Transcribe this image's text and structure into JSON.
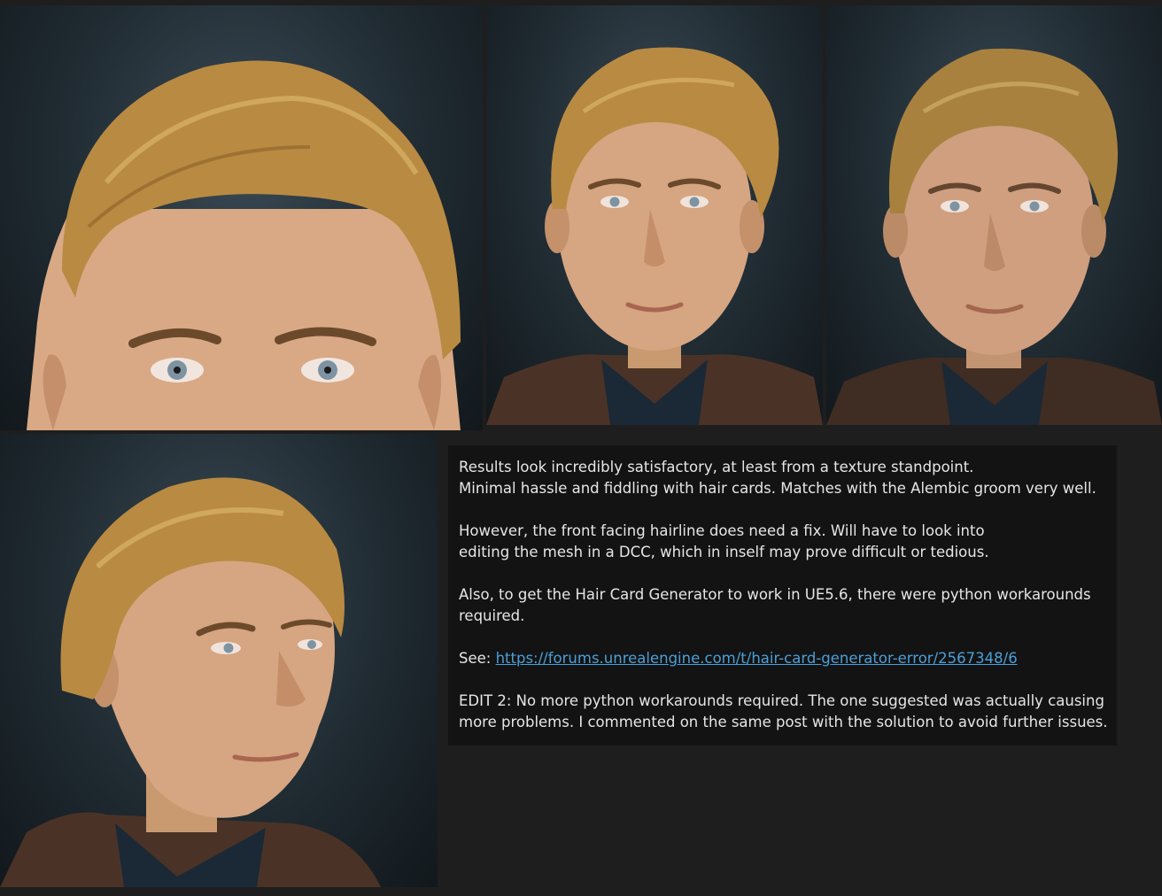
{
  "note": {
    "p1_line1": "Results look incredibly satisfactory, at least from a texture standpoint.",
    "p1_line2": "Minimal hassle and fiddling with hair cards. Matches with the Alembic groom very well.",
    "p2_line1": "However, the front facing hairline does need a fix. Will have to look into",
    "p2_line2": "editing the mesh in a DCC, which in inself may prove difficult or tedious.",
    "p3_line1": "Also, to get the Hair Card Generator to work in UE5.6, there were python workarounds",
    "p3_line2": "required.",
    "see_label": "See: ",
    "see_link": "https://forums.unrealengine.com/t/hair-card-generator-error/2567348/6",
    "p5_line1": "EDIT 2: No more python workarounds required. The one suggested was actually causing",
    "p5_line2": "more problems. I commented on the same post with the solution to avoid further issues."
  },
  "colors": {
    "page_bg": "#1e1e1e",
    "note_bg": "#131313",
    "text": "#e6e6e6",
    "link": "#4a9fd8",
    "hair": "#b88a3e",
    "skin": "#d4a27e",
    "render_bg": "#2b3840"
  }
}
